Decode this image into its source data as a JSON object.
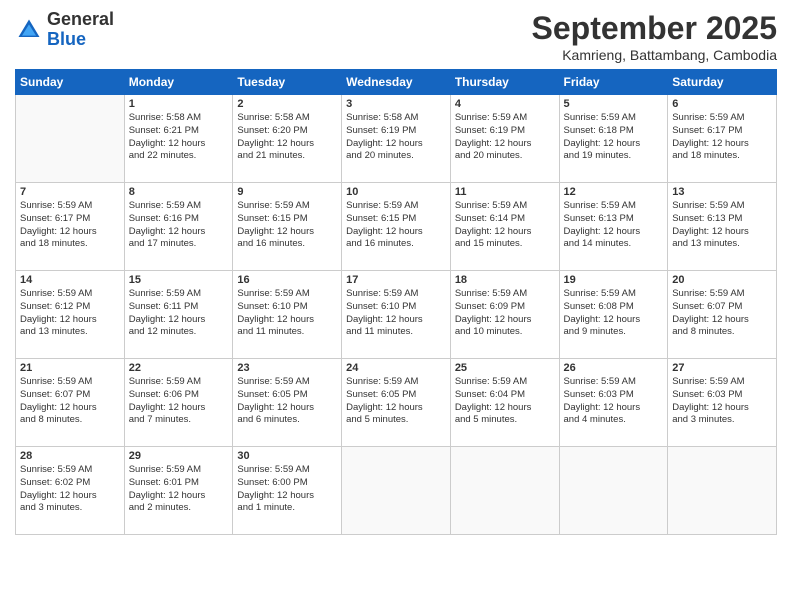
{
  "header": {
    "logo_line1": "General",
    "logo_line2": "Blue",
    "month": "September 2025",
    "location": "Kamrieng, Battambang, Cambodia"
  },
  "weekdays": [
    "Sunday",
    "Monday",
    "Tuesday",
    "Wednesday",
    "Thursday",
    "Friday",
    "Saturday"
  ],
  "weeks": [
    [
      {
        "day": "",
        "detail": ""
      },
      {
        "day": "1",
        "detail": "Sunrise: 5:58 AM\nSunset: 6:21 PM\nDaylight: 12 hours\nand 22 minutes."
      },
      {
        "day": "2",
        "detail": "Sunrise: 5:58 AM\nSunset: 6:20 PM\nDaylight: 12 hours\nand 21 minutes."
      },
      {
        "day": "3",
        "detail": "Sunrise: 5:58 AM\nSunset: 6:19 PM\nDaylight: 12 hours\nand 20 minutes."
      },
      {
        "day": "4",
        "detail": "Sunrise: 5:59 AM\nSunset: 6:19 PM\nDaylight: 12 hours\nand 20 minutes."
      },
      {
        "day": "5",
        "detail": "Sunrise: 5:59 AM\nSunset: 6:18 PM\nDaylight: 12 hours\nand 19 minutes."
      },
      {
        "day": "6",
        "detail": "Sunrise: 5:59 AM\nSunset: 6:17 PM\nDaylight: 12 hours\nand 18 minutes."
      }
    ],
    [
      {
        "day": "7",
        "detail": "Sunrise: 5:59 AM\nSunset: 6:17 PM\nDaylight: 12 hours\nand 18 minutes."
      },
      {
        "day": "8",
        "detail": "Sunrise: 5:59 AM\nSunset: 6:16 PM\nDaylight: 12 hours\nand 17 minutes."
      },
      {
        "day": "9",
        "detail": "Sunrise: 5:59 AM\nSunset: 6:15 PM\nDaylight: 12 hours\nand 16 minutes."
      },
      {
        "day": "10",
        "detail": "Sunrise: 5:59 AM\nSunset: 6:15 PM\nDaylight: 12 hours\nand 16 minutes."
      },
      {
        "day": "11",
        "detail": "Sunrise: 5:59 AM\nSunset: 6:14 PM\nDaylight: 12 hours\nand 15 minutes."
      },
      {
        "day": "12",
        "detail": "Sunrise: 5:59 AM\nSunset: 6:13 PM\nDaylight: 12 hours\nand 14 minutes."
      },
      {
        "day": "13",
        "detail": "Sunrise: 5:59 AM\nSunset: 6:13 PM\nDaylight: 12 hours\nand 13 minutes."
      }
    ],
    [
      {
        "day": "14",
        "detail": "Sunrise: 5:59 AM\nSunset: 6:12 PM\nDaylight: 12 hours\nand 13 minutes."
      },
      {
        "day": "15",
        "detail": "Sunrise: 5:59 AM\nSunset: 6:11 PM\nDaylight: 12 hours\nand 12 minutes."
      },
      {
        "day": "16",
        "detail": "Sunrise: 5:59 AM\nSunset: 6:10 PM\nDaylight: 12 hours\nand 11 minutes."
      },
      {
        "day": "17",
        "detail": "Sunrise: 5:59 AM\nSunset: 6:10 PM\nDaylight: 12 hours\nand 11 minutes."
      },
      {
        "day": "18",
        "detail": "Sunrise: 5:59 AM\nSunset: 6:09 PM\nDaylight: 12 hours\nand 10 minutes."
      },
      {
        "day": "19",
        "detail": "Sunrise: 5:59 AM\nSunset: 6:08 PM\nDaylight: 12 hours\nand 9 minutes."
      },
      {
        "day": "20",
        "detail": "Sunrise: 5:59 AM\nSunset: 6:07 PM\nDaylight: 12 hours\nand 8 minutes."
      }
    ],
    [
      {
        "day": "21",
        "detail": "Sunrise: 5:59 AM\nSunset: 6:07 PM\nDaylight: 12 hours\nand 8 minutes."
      },
      {
        "day": "22",
        "detail": "Sunrise: 5:59 AM\nSunset: 6:06 PM\nDaylight: 12 hours\nand 7 minutes."
      },
      {
        "day": "23",
        "detail": "Sunrise: 5:59 AM\nSunset: 6:05 PM\nDaylight: 12 hours\nand 6 minutes."
      },
      {
        "day": "24",
        "detail": "Sunrise: 5:59 AM\nSunset: 6:05 PM\nDaylight: 12 hours\nand 5 minutes."
      },
      {
        "day": "25",
        "detail": "Sunrise: 5:59 AM\nSunset: 6:04 PM\nDaylight: 12 hours\nand 5 minutes."
      },
      {
        "day": "26",
        "detail": "Sunrise: 5:59 AM\nSunset: 6:03 PM\nDaylight: 12 hours\nand 4 minutes."
      },
      {
        "day": "27",
        "detail": "Sunrise: 5:59 AM\nSunset: 6:03 PM\nDaylight: 12 hours\nand 3 minutes."
      }
    ],
    [
      {
        "day": "28",
        "detail": "Sunrise: 5:59 AM\nSunset: 6:02 PM\nDaylight: 12 hours\nand 3 minutes."
      },
      {
        "day": "29",
        "detail": "Sunrise: 5:59 AM\nSunset: 6:01 PM\nDaylight: 12 hours\nand 2 minutes."
      },
      {
        "day": "30",
        "detail": "Sunrise: 5:59 AM\nSunset: 6:00 PM\nDaylight: 12 hours\nand 1 minute."
      },
      {
        "day": "",
        "detail": ""
      },
      {
        "day": "",
        "detail": ""
      },
      {
        "day": "",
        "detail": ""
      },
      {
        "day": "",
        "detail": ""
      }
    ]
  ]
}
